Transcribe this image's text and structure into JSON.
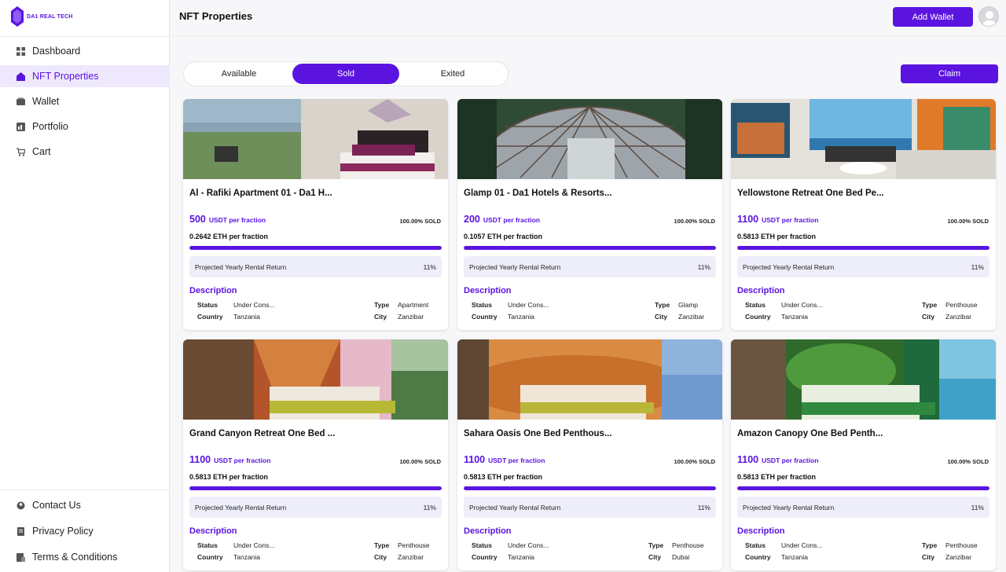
{
  "brand": {
    "name": "DA1 REAL TECH",
    "color": "#5b14e0"
  },
  "sidebar": {
    "items": [
      {
        "label": "Dashboard",
        "icon": "grid-icon",
        "active": false
      },
      {
        "label": "NFT Properties",
        "icon": "home-icon",
        "active": true
      },
      {
        "label": "Wallet",
        "icon": "wallet-icon",
        "active": false
      },
      {
        "label": "Portfolio",
        "icon": "portfolio-icon",
        "active": false
      },
      {
        "label": "Cart",
        "icon": "cart-icon",
        "active": false
      }
    ],
    "bottom_items": [
      {
        "label": "Contact Us",
        "icon": "contact-icon"
      },
      {
        "label": "Privacy Policy",
        "icon": "document-icon"
      },
      {
        "label": "Terms & Conditions",
        "icon": "terms-icon"
      }
    ]
  },
  "header": {
    "title": "NFT Properties",
    "add_wallet_label": "Add Wallet"
  },
  "tabs": [
    {
      "label": "Available",
      "active": false
    },
    {
      "label": "Sold",
      "active": true
    },
    {
      "label": "Exited",
      "active": false
    }
  ],
  "claim_label": "Claim",
  "card_labels": {
    "price_unit": "USDT per fraction",
    "eth_unit": "ETH per fraction",
    "return_label": "Projected Yearly Rental Return",
    "description": "Description",
    "status": "Status",
    "type": "Type",
    "country": "Country",
    "city": "City"
  },
  "cards": [
    {
      "title": "Al - Rafiki Apartment 01 - Da1 H...",
      "price": "500",
      "eth": "0.2642",
      "sold": "100.00% SOLD",
      "sold_fraction": 1.0,
      "return": "11%",
      "status": "Under Cons...",
      "type": "Apartment",
      "country": "Tanzania",
      "city": "Zanzibar"
    },
    {
      "title": "Glamp 01 - Da1 Hotels & Resorts...",
      "price": "200",
      "eth": "0.1057",
      "sold": "100.00% SOLD",
      "sold_fraction": 1.0,
      "return": "11%",
      "status": "Under Cons...",
      "type": "Glamp",
      "country": "Tanzania",
      "city": "Zanzibar"
    },
    {
      "title": "Yellowstone Retreat One Bed Pe...",
      "price": "1100",
      "eth": "0.5813",
      "sold": "100.00% SOLD",
      "sold_fraction": 1.0,
      "return": "11%",
      "status": "Under Cons...",
      "type": "Penthouse",
      "country": "Tanzania",
      "city": "Zanzibar"
    },
    {
      "title": "Grand Canyon Retreat One Bed ...",
      "price": "1100",
      "eth": "0.5813",
      "sold": "100.00% SOLD",
      "sold_fraction": 1.0,
      "return": "11%",
      "status": "Under Cons...",
      "type": "Penthouse",
      "country": "Tanzania",
      "city": "Zanzibar"
    },
    {
      "title": "Sahara Oasis One Bed Penthous...",
      "price": "1100",
      "eth": "0.5813",
      "sold": "100.00% SOLD",
      "sold_fraction": 1.0,
      "return": "11%",
      "status": "Under Cons...",
      "type": "Penthouse",
      "country": "Tanzania",
      "city": "Dubai"
    },
    {
      "title": "Amazon Canopy One Bed Penth...",
      "price": "1100",
      "eth": "0.5813",
      "sold": "100.00% SOLD",
      "sold_fraction": 1.0,
      "return": "11%",
      "status": "Under Cons...",
      "type": "Penthouse",
      "country": "Tanzania",
      "city": "Zanzibar"
    }
  ]
}
